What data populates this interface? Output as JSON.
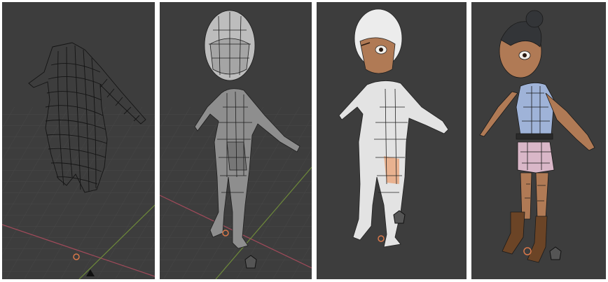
{
  "panels": [
    {
      "stage": "wireframe-body",
      "view": "perspective-viewport"
    },
    {
      "stage": "solid-mesh-with-head",
      "view": "perspective-viewport"
    },
    {
      "stage": "face-textured-mesh",
      "view": "perspective-viewport"
    },
    {
      "stage": "fully-colored-character",
      "view": "perspective-viewport"
    }
  ],
  "colors": {
    "viewport_background": "#3d3d3d",
    "grid_line": "#4a4a4a",
    "x_axis": "#a04a5a",
    "y_axis": "#6e8a3a",
    "cursor": "#d9784a",
    "mesh_edge": "#141414",
    "clay_mesh": "#9a9a9a",
    "white_mesh": "#e3e3e3",
    "skin": "#b07a55",
    "hair": "#333538",
    "shirt": "#9fb3d8",
    "shorts": "#d9b7c8",
    "boots": "#6b4426"
  },
  "icons": [
    "3d-cursor-icon",
    "camera-icon",
    "light-icon"
  ]
}
